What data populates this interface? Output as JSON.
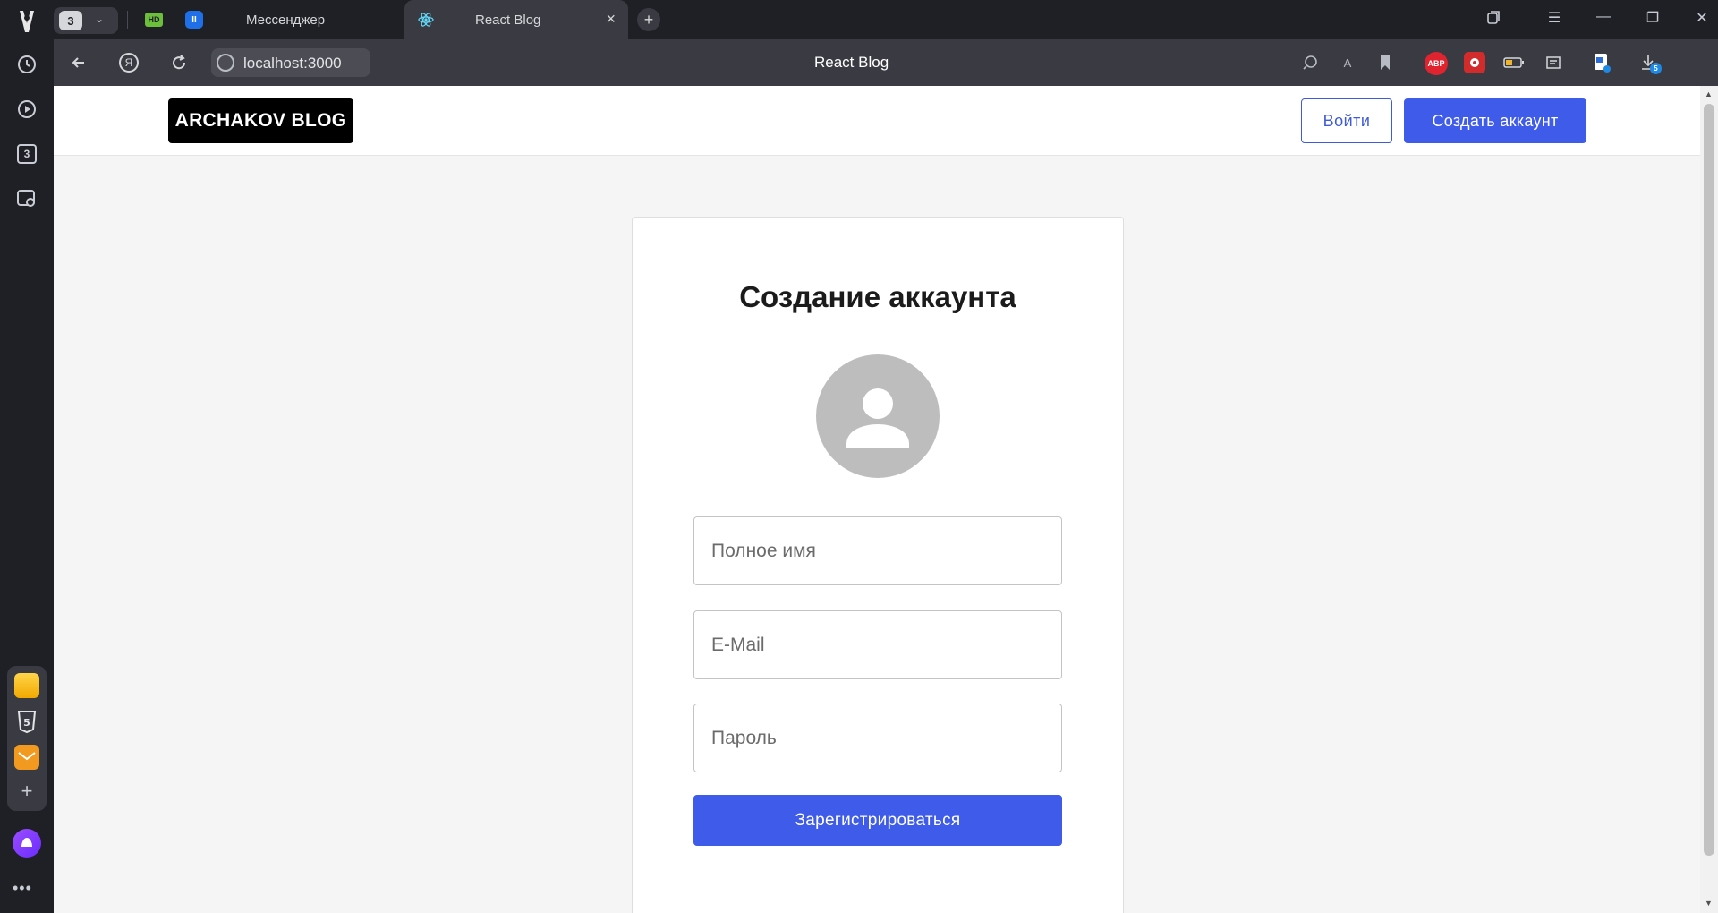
{
  "browser": {
    "tab_counter": "3",
    "pinned_tabs": [
      {
        "label": "HD",
        "icon": "hd-icon"
      },
      {
        "label": "II",
        "icon": "pause-icon"
      }
    ],
    "tabs": [
      {
        "label": "Мессенджер",
        "active": false
      },
      {
        "label": "React Blog",
        "active": true,
        "close": "×"
      }
    ],
    "new_tab": "+",
    "window_controls": [
      "▢",
      "☰",
      "—",
      "❐",
      "✕"
    ],
    "address": {
      "url": "localhost:3000",
      "page_title": "React Blog",
      "yandex_icon_text": "Я"
    },
    "extensions": [
      {
        "name": "zoom-icon",
        "text": ""
      },
      {
        "name": "translate-icon",
        "text": "A"
      },
      {
        "name": "bookmark-icon",
        "text": ""
      },
      {
        "name": "adblock-icon",
        "text": "ABP"
      },
      {
        "name": "fire-ext-icon",
        "text": ""
      },
      {
        "name": "battery-icon",
        "text": ""
      },
      {
        "name": "notes-icon",
        "text": ""
      },
      {
        "name": "doc-ext-icon",
        "text": ""
      },
      {
        "name": "downloads-icon",
        "text": "5"
      }
    ],
    "left_sidebar": {
      "history_count": "3",
      "more": "•••"
    }
  },
  "site": {
    "logo": "ARCHAKOV BLOG",
    "login_label": "Войти",
    "create_account_label": "Создать аккаунт"
  },
  "form": {
    "title": "Создание аккаунта",
    "fields": [
      {
        "placeholder": "Полное имя",
        "value": ""
      },
      {
        "placeholder": "E-Mail",
        "value": ""
      },
      {
        "placeholder": "Пароль",
        "value": ""
      }
    ],
    "submit_label": "Зарегистрироваться"
  },
  "colors": {
    "accent": "#3f5bea",
    "browser_dark": "#1f2026",
    "browser_bar": "#3a3b42",
    "page_bg": "#f5f5f5"
  }
}
